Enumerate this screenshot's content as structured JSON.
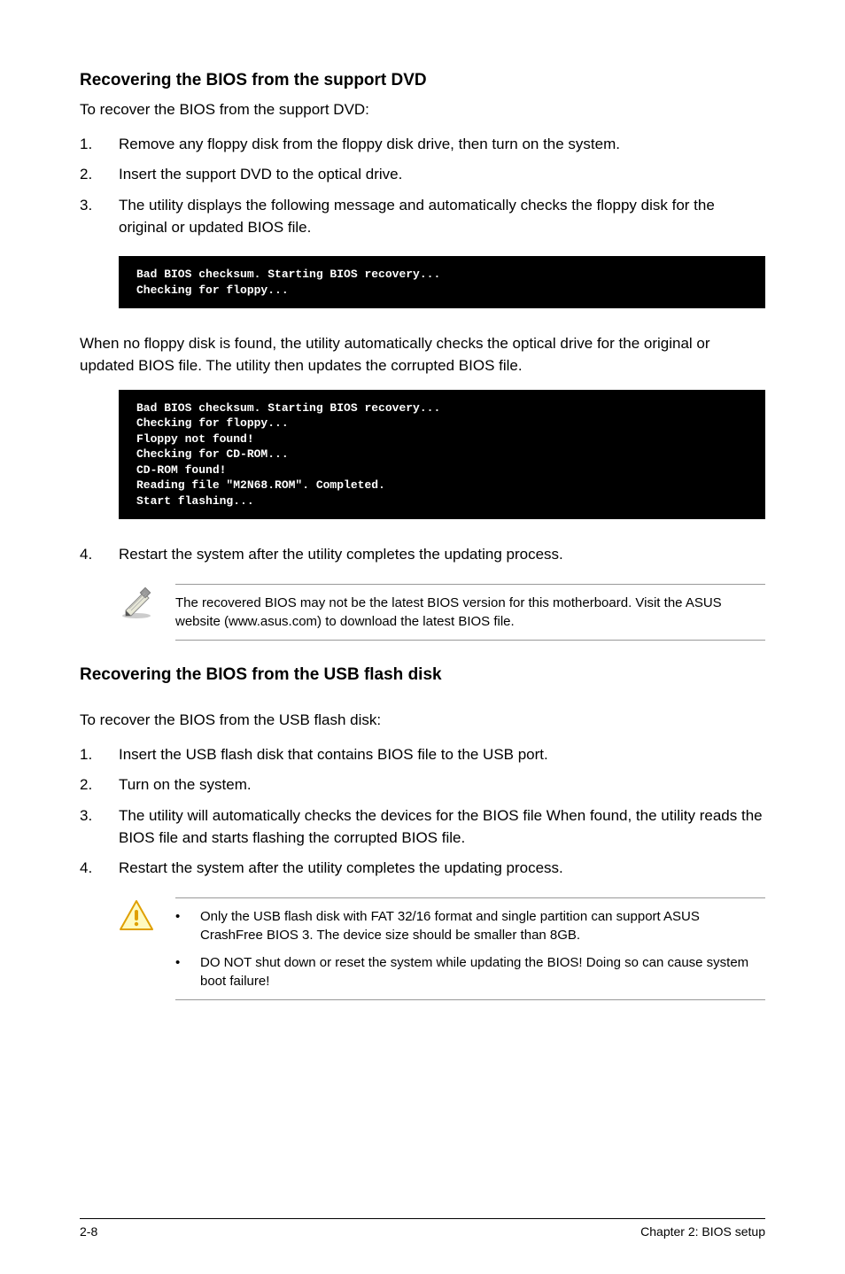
{
  "section1": {
    "heading": "Recovering the BIOS from the support DVD",
    "intro": "To recover the BIOS from the support DVD:",
    "steps": [
      {
        "num": "1.",
        "text": "Remove any floppy disk from the floppy disk drive, then turn on the system."
      },
      {
        "num": "2.",
        "text": "Insert the support DVD to the optical drive."
      },
      {
        "num": "3.",
        "text": "The utility displays the following message and automatically checks the floppy disk for the original or updated BIOS file."
      }
    ],
    "terminal1": "Bad BIOS checksum. Starting BIOS recovery...\nChecking for floppy...",
    "mid_text": "When no floppy disk is found, the utility automatically checks the optical drive for the original or updated BIOS file. The utility then updates the corrupted BIOS file.",
    "terminal2": "Bad BIOS checksum. Starting BIOS recovery...\nChecking for floppy...\nFloppy not found!\nChecking for CD-ROM...\nCD-ROM found!\nReading file \"M2N68.ROM\". Completed.\nStart flashing...",
    "step4": {
      "num": "4.",
      "text": "Restart the system after the utility completes the updating process."
    },
    "note": "The recovered BIOS may not be the latest BIOS version for this motherboard. Visit the ASUS website (www.asus.com) to download the latest BIOS file."
  },
  "section2": {
    "heading": "Recovering the BIOS from the USB flash disk",
    "intro": "To recover the BIOS from the USB flash disk:",
    "steps": [
      {
        "num": "1.",
        "text": "Insert the USB flash disk that contains BIOS file to the USB port."
      },
      {
        "num": "2.",
        "text": "Turn on the system."
      },
      {
        "num": "3.",
        "text": "The utility will automatically checks the devices for the BIOS file When found, the utility reads the BIOS file and starts flashing the corrupted BIOS file."
      },
      {
        "num": "4.",
        "text": "Restart the system after the utility completes the updating process."
      }
    ],
    "warn_bullets": [
      "Only the USB flash disk with FAT 32/16 format and single partition can support ASUS CrashFree BIOS 3. The device size should be smaller than 8GB.",
      "DO NOT shut down or reset the system while updating the BIOS! Doing so can cause system boot failure!"
    ]
  },
  "footer": {
    "page": "2-8",
    "chapter": "Chapter 2: BIOS setup"
  },
  "bullet_char": "•"
}
